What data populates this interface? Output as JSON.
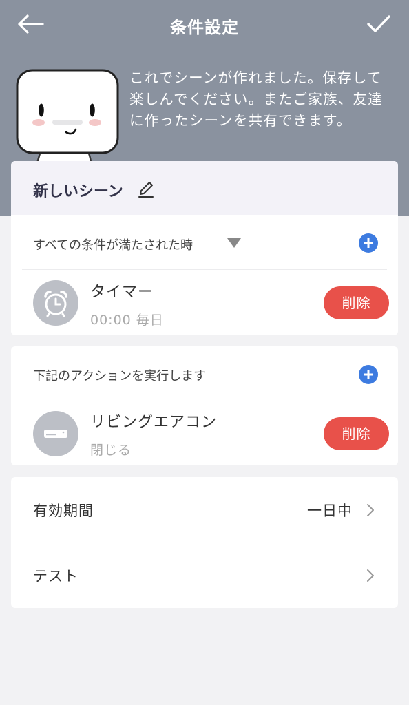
{
  "nav": {
    "title": "条件設定",
    "back_icon": "arrow-left-icon",
    "confirm_icon": "checkmark-icon"
  },
  "intro": {
    "text": "これでシーンが作れました。保存して楽しんでください。またご家族、友達に作ったシーンを共有できます。"
  },
  "scene": {
    "name": "新しいシーン",
    "edit_icon": "pencil-icon"
  },
  "conditions": {
    "label": "すべての条件が満たされた時",
    "items": [
      {
        "icon": "alarm-clock-icon",
        "title": "タイマー",
        "subtitle": "00:00 毎日",
        "delete_label": "削除"
      }
    ]
  },
  "actions": {
    "label": "下記のアクションを実行します",
    "items": [
      {
        "icon": "air-conditioner-icon",
        "title": "リビングエアコン",
        "subtitle": "閉じる",
        "delete_label": "削除"
      }
    ]
  },
  "settings": [
    {
      "label": "有効期間",
      "value": "一日中"
    },
    {
      "label": "テスト",
      "value": ""
    }
  ],
  "colors": {
    "header_bg": "#8a929f",
    "accent_blue": "#3d7be0",
    "delete_red": "#e8514a",
    "page_bg": "#f2f2f4"
  }
}
